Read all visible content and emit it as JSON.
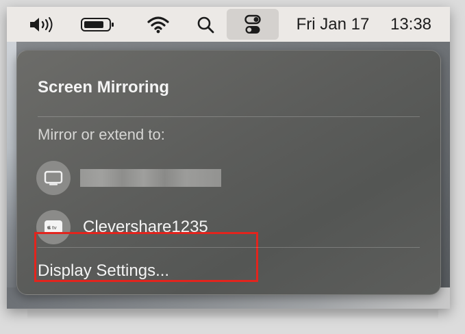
{
  "menubar": {
    "date": "Fri Jan 17",
    "time": "13:38",
    "icons": [
      "volume-icon",
      "battery-icon",
      "wifi-icon",
      "search-icon",
      "control-center-icon"
    ]
  },
  "panel": {
    "title": "Screen Mirroring",
    "section_label": "Mirror or extend to:",
    "devices": [
      {
        "name": "",
        "icon": "display-icon",
        "redacted": true
      },
      {
        "name": "Clevershare1235",
        "icon": "apple-tv-icon",
        "icon_text": "tv"
      }
    ],
    "footer_label": "Display Settings..."
  },
  "colors": {
    "highlight": "#e3241d",
    "menubar": "#ece9e6",
    "panel": "#5c5d5b"
  }
}
